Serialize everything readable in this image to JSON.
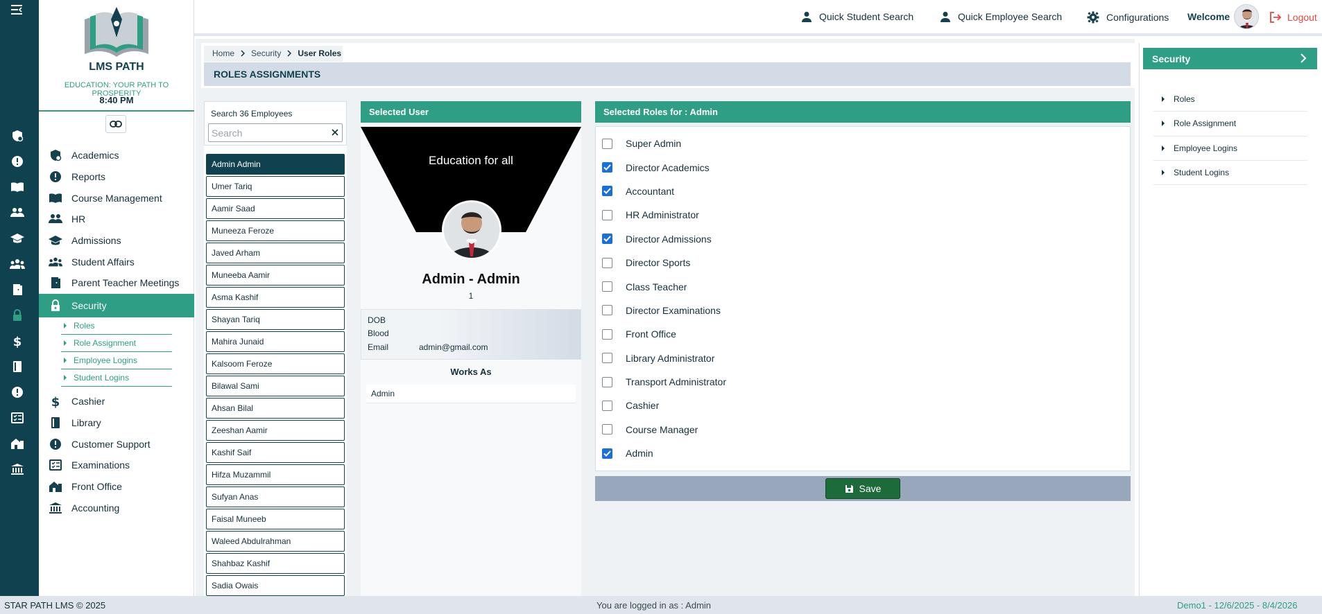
{
  "brand": {
    "name": "LMS PATH",
    "tagline": "EDUCATION: YOUR PATH TO PROSPERITY",
    "time": "8:40 PM"
  },
  "topbar": {
    "quick_student": "Quick Student Search",
    "quick_employee": "Quick Employee Search",
    "configurations": "Configurations",
    "welcome": "Welcome",
    "logout": "Logout"
  },
  "nav": {
    "items": [
      {
        "label": "Academics",
        "icon": "academics-icon"
      },
      {
        "label": "Reports",
        "icon": "reports-icon"
      },
      {
        "label": "Course Management",
        "icon": "book-icon"
      },
      {
        "label": "HR",
        "icon": "people-icon"
      },
      {
        "label": "Admissions",
        "icon": "graduation-cap-icon"
      },
      {
        "label": "Student Affairs",
        "icon": "group-icon"
      },
      {
        "label": "Parent Teacher Meetings",
        "icon": "door-icon"
      },
      {
        "label": "Security",
        "icon": "lock-icon"
      },
      {
        "label": "Cashier",
        "icon": "dollar-icon"
      },
      {
        "label": "Library",
        "icon": "library-book-icon"
      },
      {
        "label": "Customer Support",
        "icon": "support-icon"
      },
      {
        "label": "Examinations",
        "icon": "checklist-icon"
      },
      {
        "label": "Front Office",
        "icon": "building-icon"
      },
      {
        "label": "Accounting",
        "icon": "bank-icon"
      }
    ],
    "security_sub": [
      "Roles",
      "Role Assignment",
      "Employee Logins",
      "Student Logins"
    ]
  },
  "breadcrumb": {
    "home": "Home",
    "section": "Security",
    "current": "User Roles"
  },
  "page_title": "ROLES ASSIGNMENTS",
  "employees": {
    "search_label": "Search 36 Employees",
    "search_placeholder": "Search",
    "list": [
      "Admin Admin",
      "Umer Tariq",
      "Aamir Saad",
      "Muneeza Feroze",
      "Javed Arham",
      "Muneeba Aamir",
      "Asma Kashif",
      "Shayan Tariq",
      "Mahira Junaid",
      "Kalsoom Feroze",
      "Bilawal Sami",
      "Ahsan Bilal",
      "Zeeshan Aamir",
      "Kashif Saif",
      "Hifza Muzammil",
      "Sufyan Anas",
      "Faisal Muneeb",
      "Waleed Abdulrahman",
      "Shahbaz Kashif",
      "Sadia Owais"
    ],
    "selected_index": 0
  },
  "selected_user": {
    "header": "Selected User",
    "banner_text": "Education for all",
    "name": "Admin - Admin",
    "id": "1",
    "dob_label": "DOB",
    "dob_value": "",
    "blood_label": "Blood",
    "blood_value": "",
    "email_label": "Email",
    "email_value": "admin@gmail.com",
    "works_as_title": "Works As",
    "works_as": "Admin"
  },
  "roles": {
    "header": "Selected Roles for : Admin",
    "items": [
      {
        "label": "Super Admin",
        "checked": false
      },
      {
        "label": "Director Academics",
        "checked": true
      },
      {
        "label": "Accountant",
        "checked": true
      },
      {
        "label": "HR Administrator",
        "checked": false
      },
      {
        "label": "Director Admissions",
        "checked": true
      },
      {
        "label": "Director Sports",
        "checked": false
      },
      {
        "label": "Class Teacher",
        "checked": false
      },
      {
        "label": "Director Examinations",
        "checked": false
      },
      {
        "label": "Front Office",
        "checked": false
      },
      {
        "label": "Library Administrator",
        "checked": false
      },
      {
        "label": "Transport Administrator",
        "checked": false
      },
      {
        "label": "Cashier",
        "checked": false
      },
      {
        "label": "Course Manager",
        "checked": false
      },
      {
        "label": "Admin",
        "checked": true
      }
    ],
    "save_label": "Save"
  },
  "right_panel": {
    "header": "Security",
    "items": [
      "Roles",
      "Role Assignment",
      "Employee Logins",
      "Student Logins"
    ]
  },
  "footer": {
    "left": "STAR PATH LMS © 2025",
    "center": "You are logged in as : Admin",
    "right": "Demo1 -  12/6/2025 - 8/4/2026"
  },
  "colors": {
    "primary": "#10414f",
    "accent": "#2e9e84",
    "checkbox": "#1a6fd8",
    "save": "#1d6b3b",
    "logout": "#e8473c"
  }
}
